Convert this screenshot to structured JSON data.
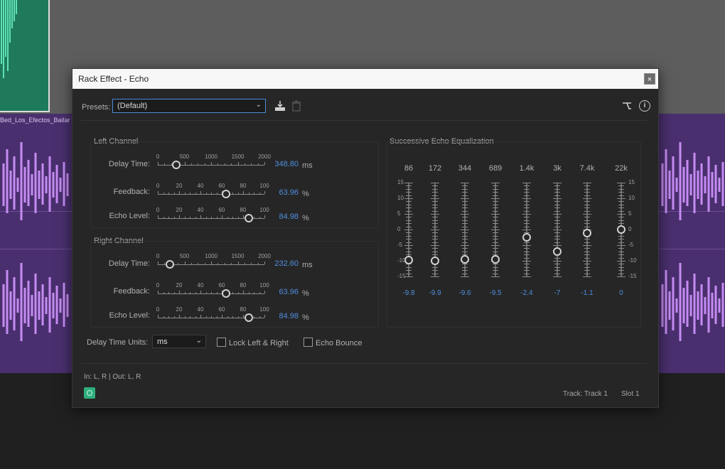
{
  "background": {
    "clip_name": "Bed_Los_Efectos_Bailar",
    "colors": {
      "green_clip": "#1f7a5c",
      "purple_track": "#4a2f6e",
      "wave_purple": "#c58cf2",
      "wave_green": "#5fe0b5"
    }
  },
  "dialog": {
    "title": "Rack Effect - Echo",
    "close_glyph": "×",
    "presets_label": "Presets:",
    "presets_value": "(Default)",
    "left_channel": {
      "title": "Left Channel",
      "delay": {
        "label": "Delay Time:",
        "scale": [
          "0",
          "500",
          "1000",
          "1500",
          "2000"
        ],
        "value": "348.80",
        "unit": "ms",
        "fraction": 0.174
      },
      "feedback": {
        "label": "Feedback:",
        "scale": [
          "0",
          "20",
          "40",
          "60",
          "80",
          "100"
        ],
        "value": "63.96",
        "unit": "%",
        "fraction": 0.64
      },
      "echo_level": {
        "label": "Echo Level:",
        "scale": [
          "0",
          "20",
          "40",
          "60",
          "80",
          "100"
        ],
        "value": "84.98",
        "unit": "%",
        "fraction": 0.85
      }
    },
    "right_channel": {
      "title": "Right Channel",
      "delay": {
        "label": "Delay Time:",
        "scale": [
          "0",
          "500",
          "1000",
          "1500",
          "2000"
        ],
        "value": "232.60",
        "unit": "ms",
        "fraction": 0.116
      },
      "feedback": {
        "label": "Feedback:",
        "scale": [
          "0",
          "20",
          "40",
          "60",
          "80",
          "100"
        ],
        "value": "63.96",
        "unit": "%",
        "fraction": 0.64
      },
      "echo_level": {
        "label": "Echo Level:",
        "scale": [
          "0",
          "20",
          "40",
          "60",
          "80",
          "100"
        ],
        "value": "84.98",
        "unit": "%",
        "fraction": 0.85
      }
    },
    "eq": {
      "title": "Successive Echo Equalization",
      "scale": [
        "15",
        "10",
        "5",
        "0",
        "-5",
        "-10",
        "-15"
      ],
      "bands": [
        {
          "freq": "86",
          "value": "-9.8",
          "db": -9.8
        },
        {
          "freq": "172",
          "value": "-9.9",
          "db": -9.9
        },
        {
          "freq": "344",
          "value": "-9.6",
          "db": -9.6
        },
        {
          "freq": "689",
          "value": "-9.5",
          "db": -9.5
        },
        {
          "freq": "1.4k",
          "value": "-2.4",
          "db": -2.4
        },
        {
          "freq": "3k",
          "value": "-7",
          "db": -7
        },
        {
          "freq": "7.4k",
          "value": "-1.1",
          "db": -1.1
        },
        {
          "freq": "22k",
          "value": "0",
          "db": 0
        }
      ]
    },
    "delay_units_label": "Delay Time Units:",
    "delay_units_value": "ms",
    "lock_label": "Lock Left & Right",
    "bounce_label": "Echo Bounce",
    "io_text": "In: L, R | Out: L, R",
    "track_text": "Track: Track 1",
    "slot_text": "Slot 1",
    "accent_color": "#4f8fe0"
  }
}
